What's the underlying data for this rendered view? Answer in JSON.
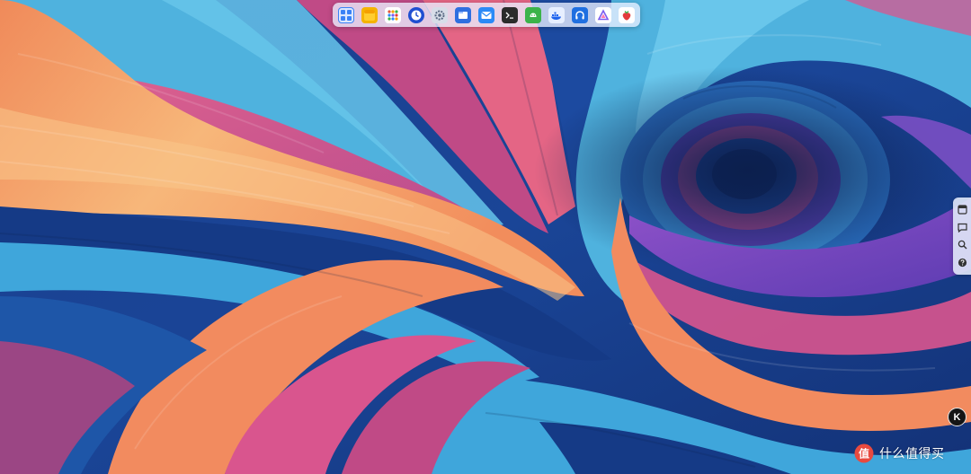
{
  "colors": {
    "wallpaper_base": "#1b3f8f",
    "swirl_orange": "#f59a5e",
    "swirl_peach": "#f7b77a",
    "swirl_pink": "#d9558e",
    "swirl_magenta": "#b2488f",
    "swirl_purple": "#7a4fc4",
    "swirl_light_blue": "#4fb2de",
    "swirl_deep_blue": "#153a86",
    "swirl_navy": "#0f2a66",
    "dock_background": "#ebf0ff"
  },
  "dock": {
    "apps": [
      {
        "name": "multitask-view-icon",
        "color": "#3b82f6"
      },
      {
        "name": "notes-icon",
        "color": "#f5b400"
      },
      {
        "name": "app-launcher-icon",
        "color": "#e2563d"
      },
      {
        "name": "clock-icon",
        "color": "#1f4fd1"
      },
      {
        "name": "settings-icon",
        "color": "#8c9bb0"
      },
      {
        "name": "file-manager-icon",
        "color": "#2f6fe0"
      },
      {
        "name": "mail-icon",
        "color": "#2b8af7"
      },
      {
        "name": "terminal-icon",
        "color": "#2b2b2b"
      },
      {
        "name": "android-icon",
        "color": "#3bb34a"
      },
      {
        "name": "docker-icon",
        "color": "#1d63ed"
      },
      {
        "name": "headphones-icon",
        "color": "#1f6fe0"
      },
      {
        "name": "prism-icon",
        "color": "#7a5cf0"
      },
      {
        "name": "strawberry-icon",
        "color": "#e33b3b"
      }
    ]
  },
  "side_toolbar": {
    "buttons": [
      {
        "name": "widget-icon"
      },
      {
        "name": "message-icon"
      },
      {
        "name": "search-icon"
      },
      {
        "name": "help-icon"
      }
    ]
  },
  "k_button": {
    "label": "K"
  },
  "watermark": {
    "text": "什么值得买"
  }
}
